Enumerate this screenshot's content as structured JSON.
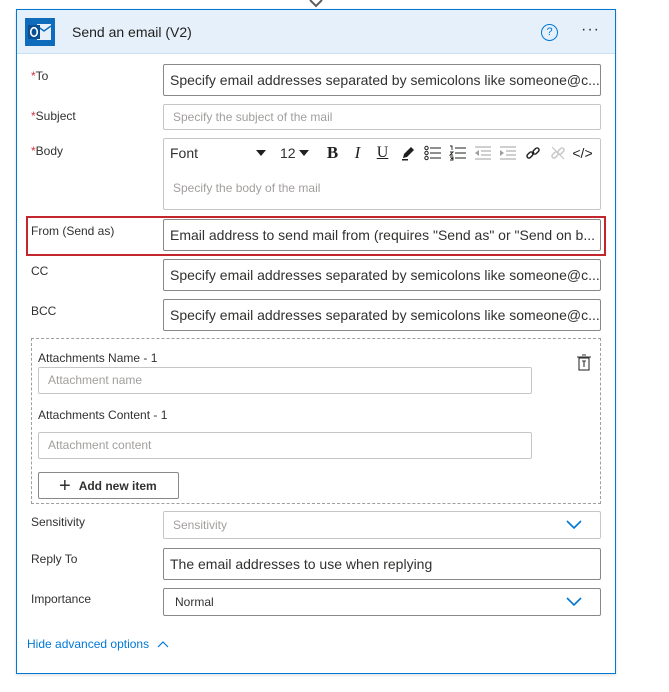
{
  "card": {
    "title": "Send an email (V2)",
    "help_icon": "?",
    "more_icon": "···"
  },
  "fields": {
    "to": {
      "label": "To",
      "required": "*",
      "placeholder": "Specify email addresses separated by semicolons like someone@c..."
    },
    "subject": {
      "label": "Subject",
      "required": "*",
      "placeholder": "Specify the subject of the mail"
    },
    "body": {
      "label": "Body",
      "required": "*",
      "placeholder": "Specify the body of the mail"
    },
    "from": {
      "label": "From (Send as)",
      "placeholder": "Email address to send mail from (requires \"Send as\" or \"Send on b..."
    },
    "cc": {
      "label": "CC",
      "placeholder": "Specify email addresses separated by semicolons like someone@c..."
    },
    "bcc": {
      "label": "BCC",
      "placeholder": "Specify email addresses separated by semicolons like someone@c..."
    },
    "sensitivity": {
      "label": "Sensitivity",
      "value": "Sensitivity"
    },
    "reply_to": {
      "label": "Reply To",
      "placeholder": "The email addresses to use when replying"
    },
    "importance": {
      "label": "Importance",
      "value": "Normal"
    }
  },
  "toolbar": {
    "font": "Font",
    "size": "12",
    "bold": "B",
    "italic": "I",
    "underline": "U",
    "code": "</>"
  },
  "attachments": {
    "name_label": "Attachments Name - 1",
    "name_placeholder": "Attachment name",
    "content_label": "Attachments Content - 1",
    "content_placeholder": "Attachment content",
    "add_button": "Add new item"
  },
  "footer": {
    "hide_advanced": "Hide advanced options"
  },
  "colors": {
    "accent": "#0078d4",
    "header_bg": "#e6f0fb",
    "highlight": "#c4262e",
    "required": "#d13438"
  }
}
